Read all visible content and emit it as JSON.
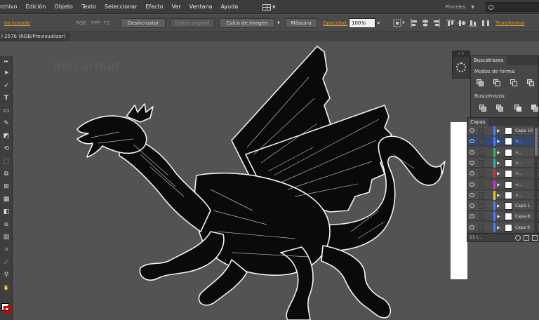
{
  "menu": [
    "rchivo",
    "Edición",
    "Objeto",
    "Texto",
    "Seleccionar",
    "Efecto",
    "Ver",
    "Ventana",
    "Ayuda"
  ],
  "workspace": {
    "name": "Pinceles"
  },
  "control": {
    "incrustado": "Incrustado",
    "mode": "RGB",
    "ppp": "PPP: 72",
    "desincrustar": "Desincrustar",
    "editar_original": "Editar original",
    "calco": "Calco de imagen",
    "mascara": "Máscara",
    "opacidad_label": "Opacidad:",
    "opacidad_value": "100%",
    "transformar": "Transformar"
  },
  "document": {
    "tab_title": "l 2576 (RGB/Previsualizar)"
  },
  "canvas": {
    "watermark": "delcarmat"
  },
  "pathfinder": {
    "tab": "Buscatrazos",
    "modos_label": "Modos de forma:",
    "buscatrazos_label": "Buscatrazos:"
  },
  "layers": {
    "tab": "Capas",
    "rows": [
      {
        "name": "Capa 10",
        "color": "#4a7cff",
        "selected": false
      },
      {
        "name": "<...",
        "color": "#4a7cff",
        "selected": true
      },
      {
        "name": "<...",
        "color": "#3cb371",
        "selected": false
      },
      {
        "name": "<...",
        "color": "#2bb3b3",
        "selected": false
      },
      {
        "name": "<...",
        "color": "#cc3333",
        "selected": false
      },
      {
        "name": "<...",
        "color": "#cc33cc",
        "selected": false
      },
      {
        "name": "<...",
        "color": "#e0d020",
        "selected": false
      },
      {
        "name": "Capa 1",
        "color": "#4a7cff",
        "selected": false
      },
      {
        "name": "Capa 8",
        "color": "#4a7cff",
        "selected": false
      },
      {
        "name": "Capa 9",
        "color": "#4a7cff",
        "selected": false
      }
    ],
    "count": "11 c..."
  },
  "colors": {
    "accent_link": "#e0a030",
    "selection": "#2f4a77",
    "ui_bg": "#535353"
  }
}
